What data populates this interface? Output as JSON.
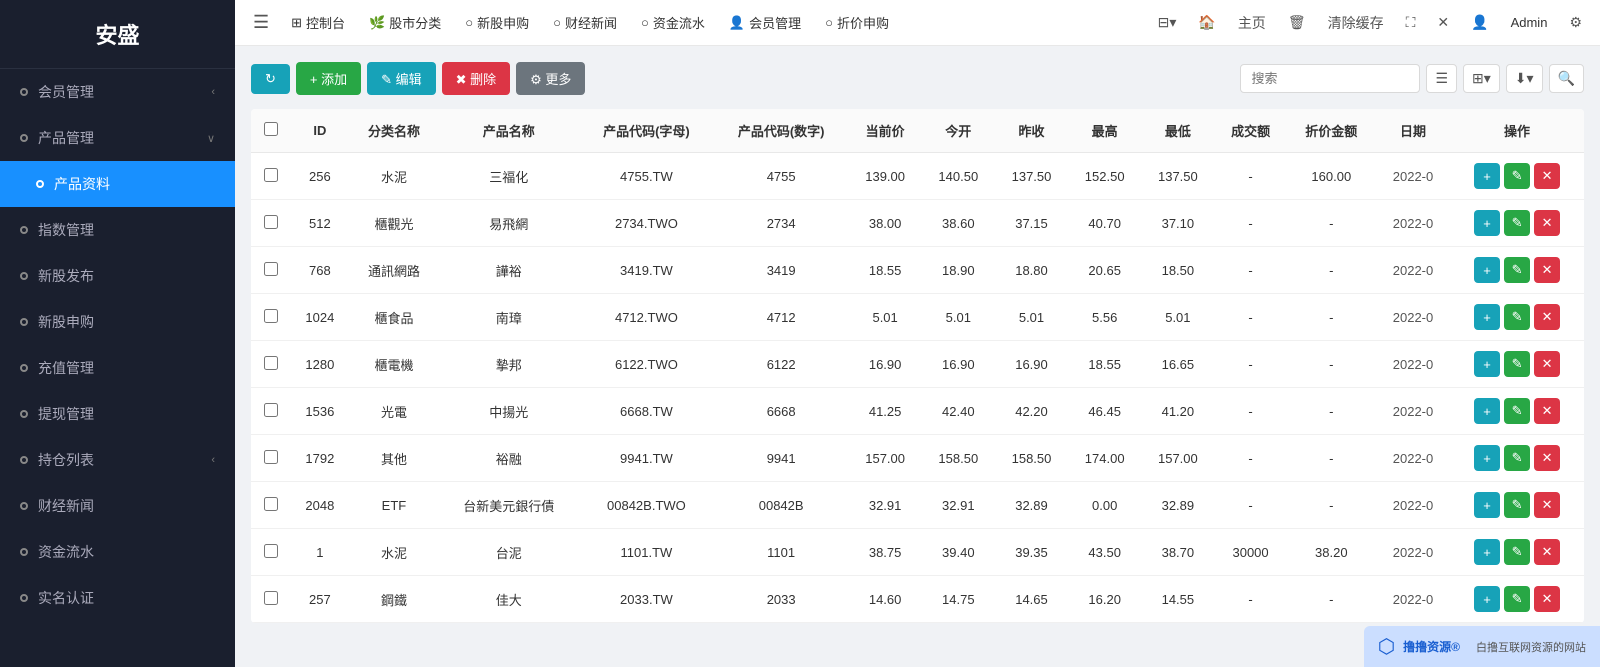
{
  "app": {
    "name": "安盛"
  },
  "topnav": {
    "items": [
      {
        "icon": "⊞",
        "label": "控制台"
      },
      {
        "icon": "🌿",
        "label": "股市分类"
      },
      {
        "icon": "○",
        "label": "新股申购"
      },
      {
        "icon": "○",
        "label": "财经新闻"
      },
      {
        "icon": "○",
        "label": "资金流水"
      },
      {
        "icon": "👤",
        "label": "会员管理"
      },
      {
        "icon": "○",
        "label": "折价申购"
      }
    ],
    "right": {
      "layout_icon": "⊟",
      "home_label": "主页",
      "clear_label": "清除缓存",
      "admin_label": "Admin",
      "settings_icon": "⚙"
    }
  },
  "sidebar": {
    "items": [
      {
        "label": "会员管理",
        "dot": true,
        "arrow": "‹",
        "active": false
      },
      {
        "label": "产品管理",
        "dot": true,
        "arrow": "∨",
        "active": false
      },
      {
        "label": "产品资料",
        "dot": true,
        "arrow": "",
        "active": true
      },
      {
        "label": "指数管理",
        "dot": true,
        "arrow": "",
        "active": false
      },
      {
        "label": "新股发布",
        "dot": true,
        "arrow": "",
        "active": false
      },
      {
        "label": "新股申购",
        "dot": true,
        "arrow": "",
        "active": false
      },
      {
        "label": "充值管理",
        "dot": true,
        "arrow": "",
        "active": false
      },
      {
        "label": "提现管理",
        "dot": true,
        "arrow": "",
        "active": false
      },
      {
        "label": "持仓列表",
        "dot": true,
        "arrow": "‹",
        "active": false
      },
      {
        "label": "财经新闻",
        "dot": true,
        "arrow": "",
        "active": false
      },
      {
        "label": "资金流水",
        "dot": true,
        "arrow": "",
        "active": false
      },
      {
        "label": "实名认证",
        "dot": true,
        "arrow": "",
        "active": false
      }
    ]
  },
  "toolbar": {
    "refresh_label": "",
    "add_label": "+ 添加",
    "edit_label": "✎ 编辑",
    "delete_label": "✖ 删除",
    "more_label": "⚙ 更多",
    "search_placeholder": "搜索"
  },
  "table": {
    "columns": [
      "ID",
      "分类名称",
      "产品名称",
      "产品代码(字母)",
      "产品代码(数字)",
      "当前价",
      "今开",
      "昨收",
      "最高",
      "最低",
      "成交额",
      "折价金额",
      "日期",
      "操作"
    ],
    "rows": [
      {
        "id": 256,
        "category": "水泥",
        "name": "三福化",
        "code_alpha": "4755.TW",
        "code_num": 4755,
        "current": "139.00",
        "open": "140.50",
        "prev_close": "137.50",
        "high": "152.50",
        "low": "137.50",
        "volume": "-",
        "discount": "160.00",
        "date": "2022-0"
      },
      {
        "id": 512,
        "category": "櫃觀光",
        "name": "易飛網",
        "code_alpha": "2734.TWO",
        "code_num": 2734,
        "current": "38.00",
        "open": "38.60",
        "prev_close": "37.15",
        "high": "40.70",
        "low": "37.10",
        "volume": "-",
        "discount": "-",
        "date": "2022-0"
      },
      {
        "id": 768,
        "category": "通訊網路",
        "name": "譁裕",
        "code_alpha": "3419.TW",
        "code_num": 3419,
        "current": "18.55",
        "open": "18.90",
        "prev_close": "18.80",
        "high": "20.65",
        "low": "18.50",
        "volume": "-",
        "discount": "-",
        "date": "2022-0"
      },
      {
        "id": 1024,
        "category": "櫃食品",
        "name": "南璋",
        "code_alpha": "4712.TWO",
        "code_num": 4712,
        "current": "5.01",
        "open": "5.01",
        "prev_close": "5.01",
        "high": "5.56",
        "low": "5.01",
        "volume": "-",
        "discount": "-",
        "date": "2022-0"
      },
      {
        "id": 1280,
        "category": "櫃電機",
        "name": "摯邦",
        "code_alpha": "6122.TWO",
        "code_num": 6122,
        "current": "16.90",
        "open": "16.90",
        "prev_close": "16.90",
        "high": "18.55",
        "low": "16.65",
        "volume": "-",
        "discount": "-",
        "date": "2022-0"
      },
      {
        "id": 1536,
        "category": "光電",
        "name": "中揚光",
        "code_alpha": "6668.TW",
        "code_num": 6668,
        "current": "41.25",
        "open": "42.40",
        "prev_close": "42.20",
        "high": "46.45",
        "low": "41.20",
        "volume": "-",
        "discount": "-",
        "date": "2022-0"
      },
      {
        "id": 1792,
        "category": "其他",
        "name": "裕融",
        "code_alpha": "9941.TW",
        "code_num": 9941,
        "current": "157.00",
        "open": "158.50",
        "prev_close": "158.50",
        "high": "174.00",
        "low": "157.00",
        "volume": "-",
        "discount": "-",
        "date": "2022-0"
      },
      {
        "id": 2048,
        "category": "ETF",
        "name": "台新美元銀行債",
        "code_alpha": "00842B.TWO",
        "code_num": "00842B",
        "current": "32.91",
        "open": "32.91",
        "prev_close": "32.89",
        "high": "0.00",
        "low": "32.89",
        "volume": "-",
        "discount": "-",
        "date": "2022-0"
      },
      {
        "id": 1,
        "category": "水泥",
        "name": "台泥",
        "code_alpha": "1101.TW",
        "code_num": 1101,
        "current": "38.75",
        "open": "39.40",
        "prev_close": "39.35",
        "high": "43.50",
        "low": "38.70",
        "volume": "30000",
        "discount": "38.20",
        "date": "2022-0"
      },
      {
        "id": 257,
        "category": "鋼鐵",
        "name": "佳大",
        "code_alpha": "2033.TW",
        "code_num": 2033,
        "current": "14.60",
        "open": "14.75",
        "prev_close": "14.65",
        "high": "16.20",
        "low": "14.55",
        "volume": "-",
        "discount": "-",
        "date": "2022-0"
      }
    ]
  }
}
